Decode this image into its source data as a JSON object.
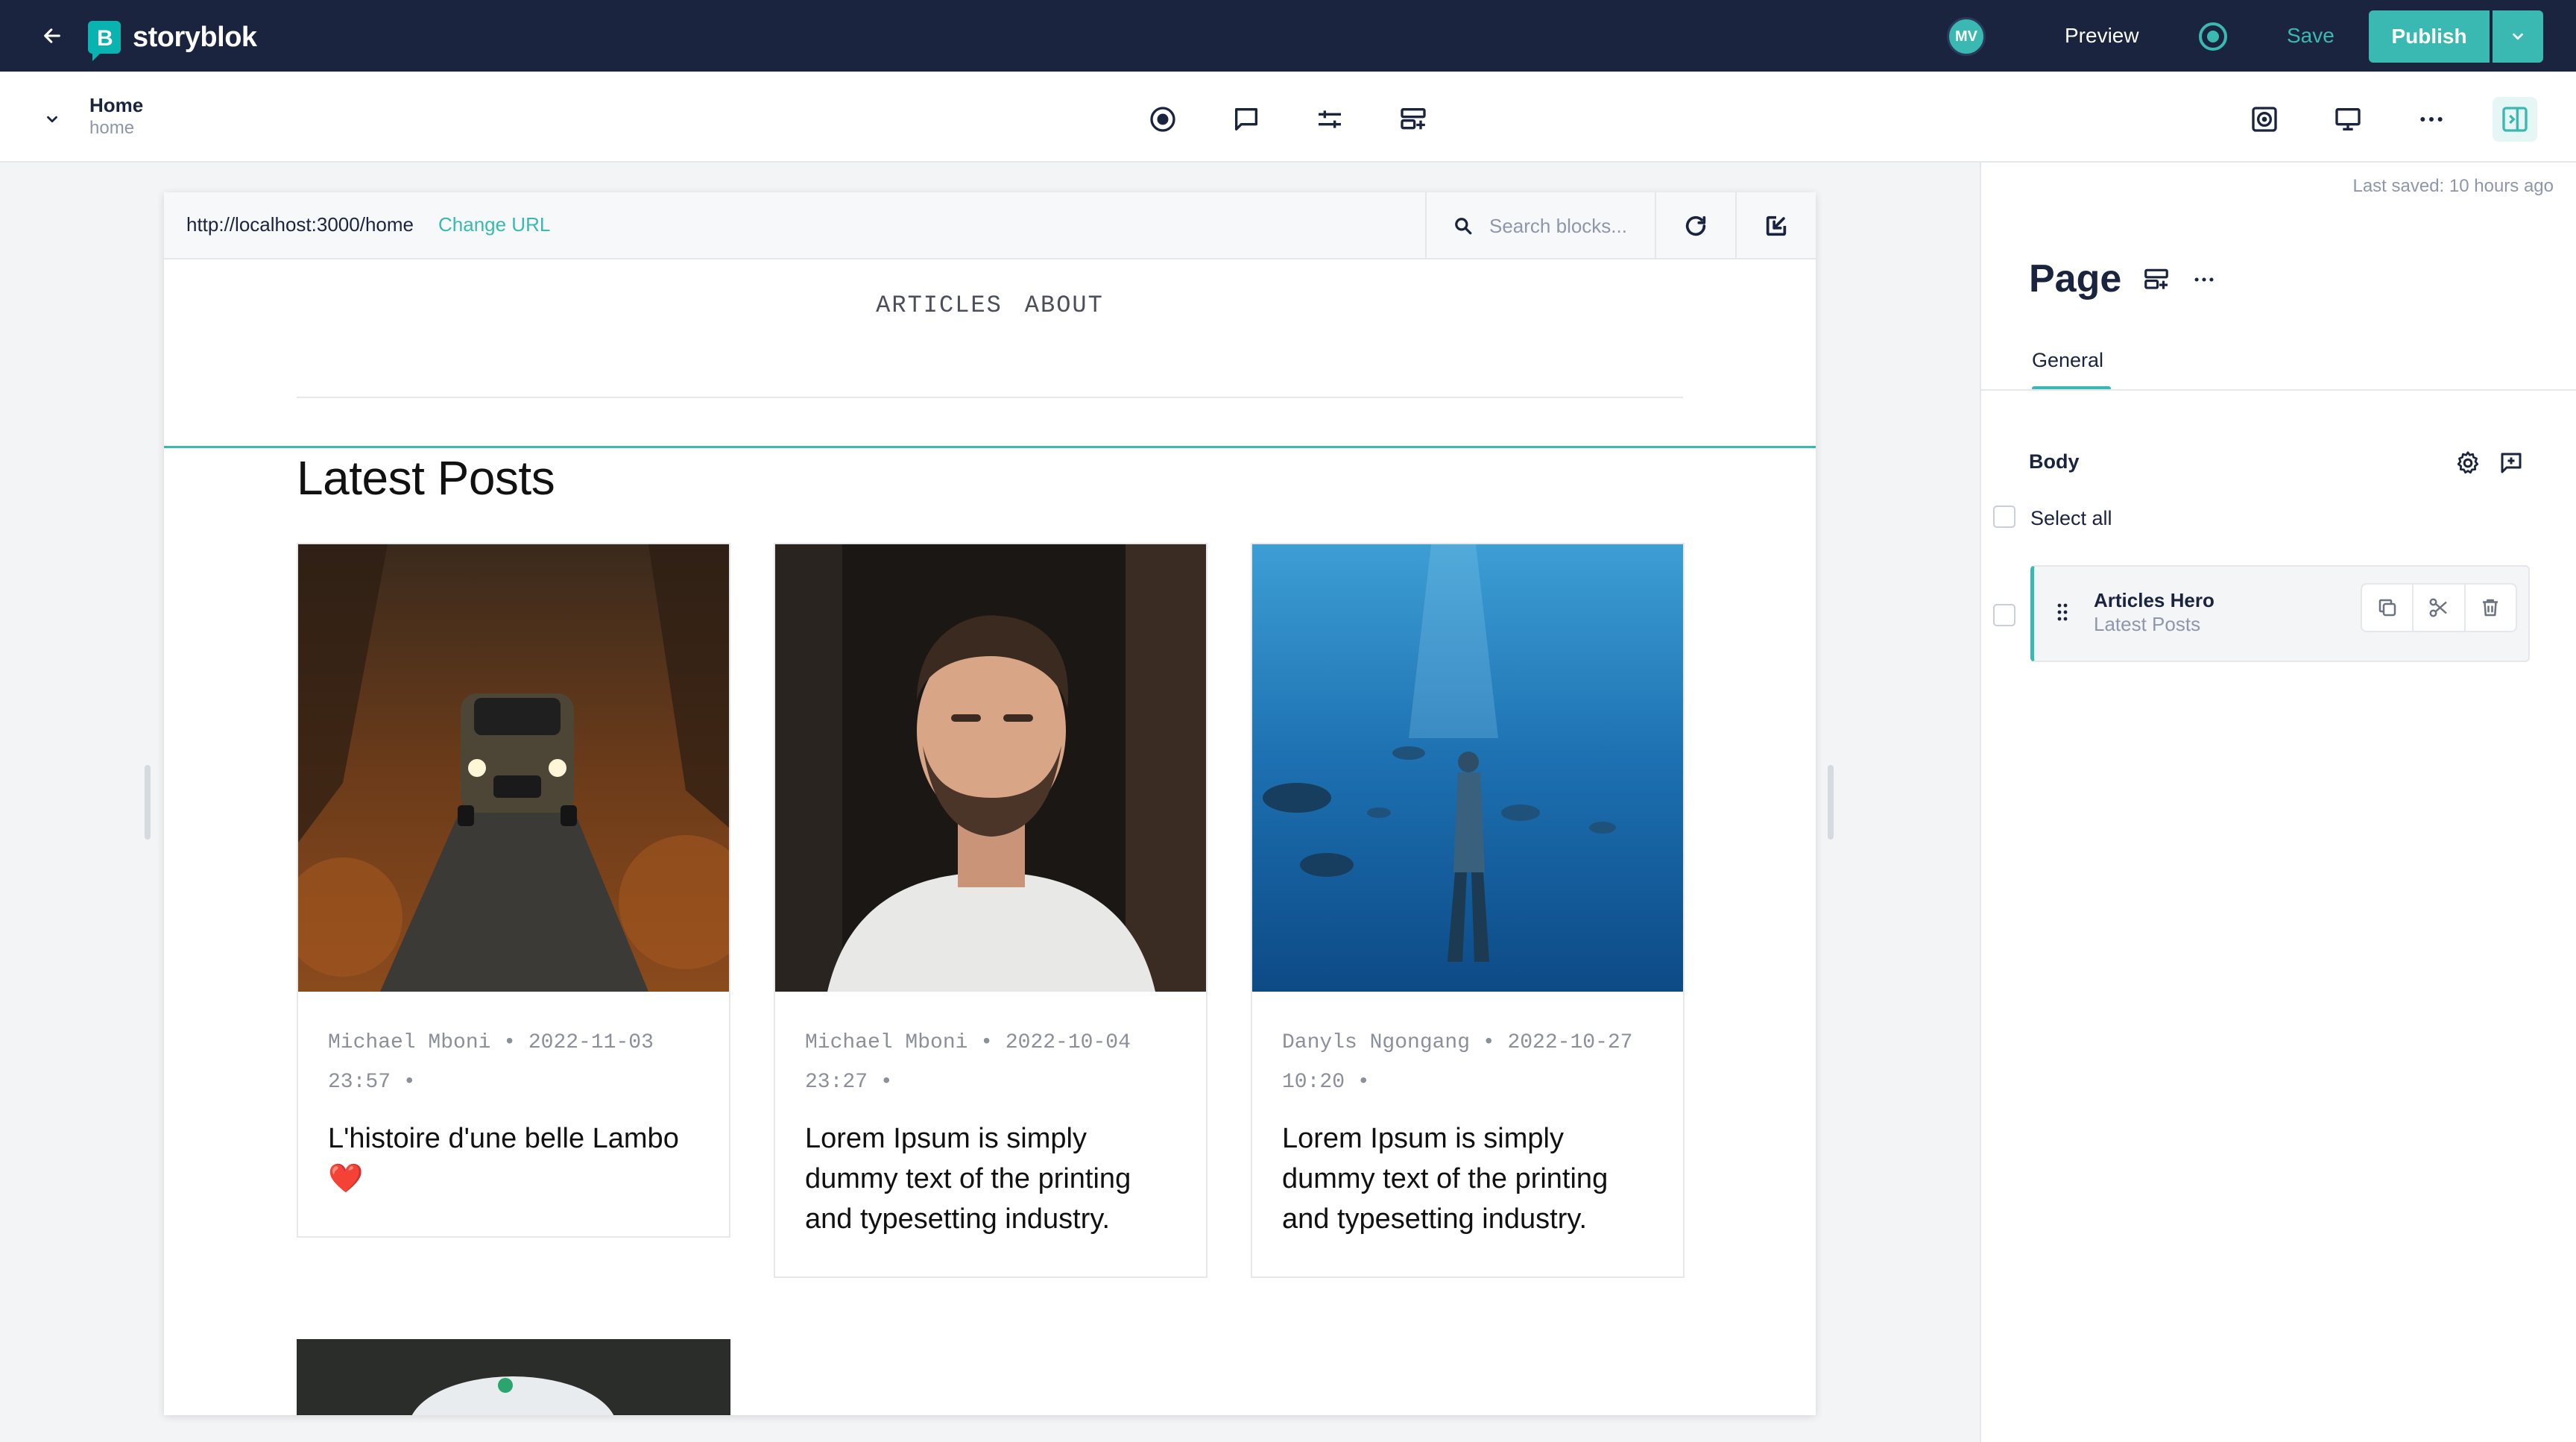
{
  "topbar": {
    "logo_text": "storyblok",
    "avatar_initials": "MV",
    "preview_label": "Preview",
    "save_label": "Save",
    "publish_label": "Publish"
  },
  "story": {
    "name": "Home",
    "slug": "home"
  },
  "toolbar_icons": [
    "target-icon",
    "comment-icon",
    "sliders-icon",
    "add-block-icon",
    "screenshot-icon",
    "desktop-icon",
    "more-icon",
    "sidebar-toggle-icon"
  ],
  "preview": {
    "url": "http://localhost:3000/home",
    "change_url": "Change URL",
    "search_placeholder": "Search blocks..."
  },
  "site": {
    "nav": [
      "ARTICLES",
      "ABOUT"
    ],
    "heading": "Latest Posts",
    "posts": [
      {
        "meta_line1": "Michael Mboni • 2022-11-03",
        "meta_line2": "23:57  •",
        "title": "L'histoire d'une belle Lambo",
        "emoji": "❤️"
      },
      {
        "meta_line1": "Michael Mboni • 2022-10-04",
        "meta_line2": "23:27  •",
        "title": "Lorem Ipsum is simply dummy text of the printing and typesetting industry."
      },
      {
        "meta_line1": "Danyls Ngongang • 2022-10-27",
        "meta_line2": "10:20  •",
        "title": "Lorem Ipsum is simply dummy text of the printing and typesetting industry."
      }
    ]
  },
  "panel": {
    "last_saved": "Last saved: 10 hours ago",
    "title": "Page",
    "tab": "General",
    "field_label": "Body",
    "select_all": "Select all",
    "blocks": [
      {
        "name": "Articles Hero",
        "subtitle": "Latest Posts"
      }
    ]
  },
  "colors": {
    "topbar": "#1b243f",
    "accent": "#3ab9b2"
  }
}
